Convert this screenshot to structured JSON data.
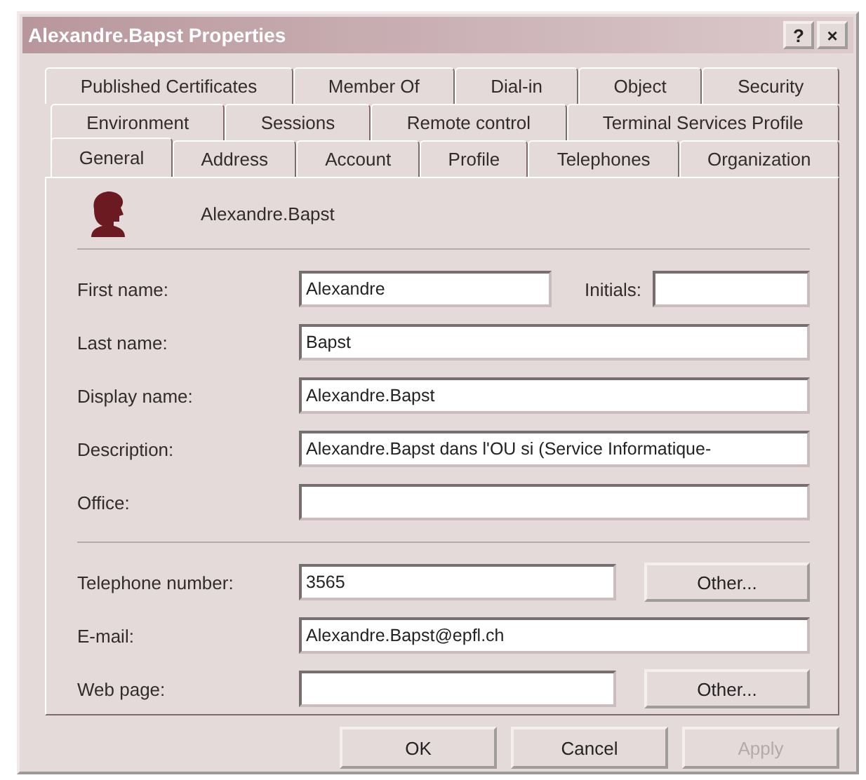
{
  "window": {
    "title": "Alexandre.Bapst Properties",
    "help_button": "?",
    "close_button": "×"
  },
  "tab_rows": [
    [
      {
        "label": "Published Certificates",
        "selected": false
      },
      {
        "label": "Member Of",
        "selected": false
      },
      {
        "label": "Dial-in",
        "selected": false
      },
      {
        "label": "Object",
        "selected": false
      },
      {
        "label": "Security",
        "selected": false
      }
    ],
    [
      {
        "label": "Environment",
        "selected": false
      },
      {
        "label": "Sessions",
        "selected": false
      },
      {
        "label": "Remote control",
        "selected": false
      },
      {
        "label": "Terminal Services Profile",
        "selected": false
      }
    ],
    [
      {
        "label": "General",
        "selected": true
      },
      {
        "label": "Address",
        "selected": false
      },
      {
        "label": "Account",
        "selected": false
      },
      {
        "label": "Profile",
        "selected": false
      },
      {
        "label": "Telephones",
        "selected": false
      },
      {
        "label": "Organization",
        "selected": false
      }
    ]
  ],
  "user": {
    "name": "Alexandre.Bapst"
  },
  "field_groups": [
    [
      {
        "label": "First name:",
        "value": "Alexandre",
        "side_label": "Initials:"
      },
      {
        "label": "Last name:",
        "value": "Bapst"
      },
      {
        "label": "Display name:",
        "value": "Alexandre.Bapst"
      },
      {
        "label": "Description:",
        "value": "Alexandre.Bapst dans l'OU si (Service Informatique-"
      },
      {
        "label": "Office:"
      }
    ],
    [
      {
        "label": "Telephone number:",
        "value": "3565",
        "button": "Other..."
      },
      {
        "label": "E-mail:",
        "value": "Alexandre.Bapst@epfl.ch"
      },
      {
        "label": "Web page:",
        "button": "Other..."
      }
    ]
  ],
  "buttons": [
    {
      "label": "OK",
      "disabled": false
    },
    {
      "label": "Cancel",
      "disabled": false
    },
    {
      "label": "Apply",
      "disabled": true
    }
  ]
}
